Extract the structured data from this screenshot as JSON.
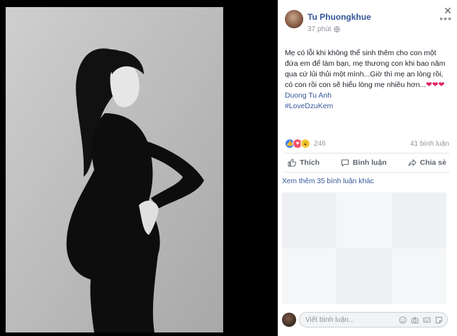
{
  "post": {
    "author": "Tu Phuongkhue",
    "time": "37 phút",
    "text_main": "Mẹ có lỗi khi không thể sinh thêm cho con một đứa em để làm bạn, mẹ thương con khi bao năm qua cứ lủi thủi một mình...Giờ thì mẹ an lòng rồi, có con rồi con sẽ hiểu lòng mẹ nhiều hơn...",
    "hearts": "❤❤❤",
    "mention": "Duong Tu Anh",
    "hashtag": "#LoveDzuKem"
  },
  "reactions": {
    "count": "246",
    "comments": "41 bình luận"
  },
  "actions": {
    "like": "Thích",
    "comment": "Bình luận",
    "share": "Chia sẻ"
  },
  "more_comments": "Xem thêm 35 bình luận khác",
  "comment_input": {
    "placeholder": "Viết bình luận..."
  },
  "colors": {
    "link": "#365899",
    "heart": "#e0245e",
    "muted": "#90949c"
  }
}
